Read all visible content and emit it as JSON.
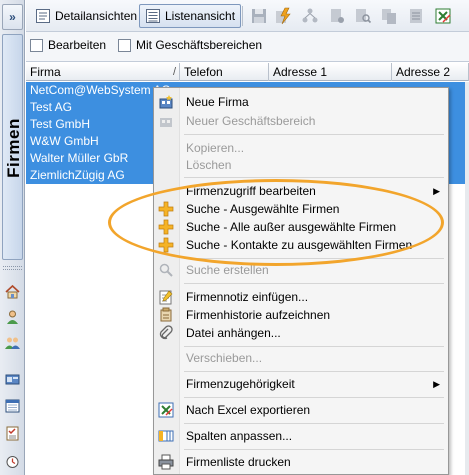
{
  "colors": {
    "selection": "#3d8fe0",
    "highlight_ring": "#f2a52c",
    "menu_bg": "#f5f5f5",
    "toolbar_active_border": "#7e98bd"
  },
  "sidebar": {
    "collapse_glyph": "»",
    "vertical_tab_label": "Firmen",
    "icons": [
      "home-icon",
      "person-icon",
      "people-icon",
      "addressbook-icon",
      "calendar-icon",
      "tasklist-icon",
      "timer-icon"
    ]
  },
  "toolbar": {
    "detail_view_label": "Detailansichten",
    "list_view_label": "Listenansicht",
    "tool_icons": [
      "save-icon",
      "lightning-icon",
      "network-icon",
      "document-settings-icon",
      "document-search-icon",
      "copy-icon",
      "excel-export-icon"
    ]
  },
  "filters": {
    "edit_label": "Bearbeiten",
    "divisions_label": "Mit Geschäftsbereichen"
  },
  "grid": {
    "columns": [
      "Firma",
      "Telefon",
      "Adresse 1",
      "Adresse 2"
    ],
    "sort_glyph": "/",
    "rows": [
      {
        "firma": "NetCom@WebSystem AG",
        "selected": true
      },
      {
        "firma": "Test AG",
        "selected": true
      },
      {
        "firma": "Test GmbH",
        "selected": true
      },
      {
        "firma": "W&W GmbH",
        "selected": true
      },
      {
        "firma": "Walter Müller GbR",
        "selected": true
      },
      {
        "firma": "ZiemlichZügig AG",
        "selected": true
      }
    ]
  },
  "context_menu": {
    "items": [
      {
        "label": "Neue Firma",
        "icon": "new-company-icon",
        "enabled": true
      },
      {
        "label": "Neuer Geschäftsbereich",
        "icon": "new-division-icon",
        "enabled": false
      },
      {
        "label": "Kopieren...",
        "enabled": false
      },
      {
        "label": "Löschen",
        "enabled": false
      },
      {
        "label": "Firmenzugriff bearbeiten",
        "enabled": true,
        "submenu": true
      },
      {
        "label": "Suche - Ausgewählte Firmen",
        "icon": "plus-icon",
        "enabled": true
      },
      {
        "label": "Suche - Alle außer ausgewählte Firmen",
        "icon": "plus-icon",
        "enabled": true
      },
      {
        "label": "Suche - Kontakte zu ausgewählten Firmen",
        "icon": "plus-icon",
        "enabled": true
      },
      {
        "label": "Suche erstellen",
        "icon": "search-icon",
        "enabled": false
      },
      {
        "label": "Firmennotiz einfügen...",
        "icon": "note-icon",
        "enabled": true
      },
      {
        "label": "Firmenhistorie aufzeichnen",
        "icon": "history-icon",
        "enabled": true
      },
      {
        "label": "Datei anhängen...",
        "icon": "paperclip-icon",
        "enabled": true
      },
      {
        "label": "Verschieben...",
        "enabled": false
      },
      {
        "label": "Firmenzugehörigkeit",
        "enabled": true,
        "submenu": true
      },
      {
        "label": "Nach Excel exportieren",
        "icon": "excel-icon",
        "enabled": true
      },
      {
        "label": "Spalten anpassen...",
        "icon": "columns-icon",
        "enabled": true
      },
      {
        "label": "Firmenliste drucken",
        "icon": "printer-icon",
        "enabled": true
      }
    ]
  }
}
